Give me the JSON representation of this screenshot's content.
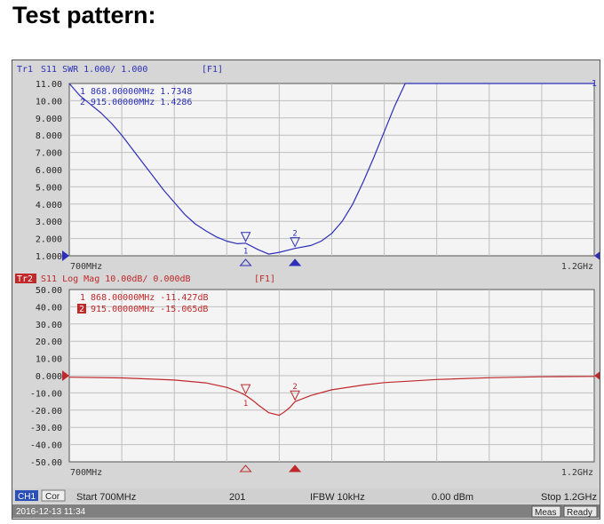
{
  "page_title": "Test pattern:",
  "colors": {
    "trace1": "#2b2fb8",
    "trace2": "#c0282a",
    "grid": "#bfbfbf",
    "screen_bg": "#d6d6d6",
    "header2_bg": "#c0282a"
  },
  "trace1": {
    "id": "Tr1",
    "header": "S11  SWR 1.000/ 1.000",
    "channel_tag": "[F1]",
    "marker_lines": [
      "1  868.00000MHz  1.7348",
      "2  915.00000MHz  1.4286"
    ],
    "y_ticks": [
      "11.00",
      "10.00",
      "9.000",
      "8.000",
      "7.000",
      "6.000",
      "5.000",
      "4.000",
      "3.000",
      "2.000",
      "1.000"
    ],
    "x_start_label": "700MHz",
    "x_stop_label": "1.2GHz",
    "right_ref_label": "1",
    "marker_numbers": [
      "1",
      "2"
    ]
  },
  "trace2": {
    "id": "Tr2",
    "header": "S11  Log Mag 10.00dB/ 0.000dB",
    "channel_tag": "[F1]",
    "marker_line1": "1  868.00000MHz  -11.427dB",
    "marker_line2_num": "2",
    "marker_line2": "915.00000MHz  -15.065dB",
    "y_ticks": [
      "50.00",
      "40.00",
      "30.00",
      "20.00",
      "10.00",
      "0.000",
      "-10.00",
      "-20.00",
      "-30.00",
      "-40.00",
      "-50.00"
    ],
    "x_start_label": "700MHz",
    "x_stop_label": "1.2GHz",
    "marker_numbers": [
      "1",
      "2"
    ]
  },
  "status_bar": {
    "channel": "CH1",
    "correction": "Cor",
    "start": "Start 700MHz",
    "points": "201",
    "ifbw": "IFBW 10kHz",
    "power": "0.00 dBm",
    "stop": "Stop 1.2GHz"
  },
  "bottom_bar": {
    "timestamp": "2016-12-13 11:34",
    "meas": "Meas",
    "ready": "Ready"
  },
  "chart_data": [
    {
      "type": "line",
      "series": [
        {
          "x": [
            700,
            710,
            720,
            730,
            740,
            750,
            760,
            770,
            780,
            790,
            800,
            810,
            820,
            830,
            840,
            850,
            860,
            868,
            880,
            890,
            900,
            915,
            930,
            940,
            950,
            960,
            970,
            980,
            990,
            1000,
            1010,
            1020,
            1030,
            1040,
            1050,
            1200
          ],
          "y": [
            11.0,
            10.3,
            9.8,
            9.3,
            8.7,
            8.0,
            7.2,
            6.4,
            5.6,
            4.8,
            4.1,
            3.4,
            2.85,
            2.45,
            2.1,
            1.85,
            1.7,
            1.73,
            1.35,
            1.1,
            1.2,
            1.43,
            1.6,
            1.85,
            2.3,
            3.0,
            4.0,
            5.3,
            6.7,
            8.2,
            9.7,
            11.0,
            11.0,
            11.0,
            11.0,
            11.0
          ]
        }
      ],
      "xlim": [
        700,
        1200
      ],
      "ylim": [
        1.0,
        11.0
      ],
      "markers": [
        {
          "n": 1,
          "x": 868,
          "y": 1.7348
        },
        {
          "n": 2,
          "x": 915,
          "y": 1.4286
        }
      ]
    },
    {
      "type": "line",
      "series": [
        {
          "x": [
            700,
            750,
            800,
            830,
            850,
            860,
            868,
            875,
            880,
            890,
            900,
            905,
            910,
            915,
            930,
            950,
            980,
            1000,
            1050,
            1100,
            1150,
            1200
          ],
          "y": [
            -0.9,
            -1.3,
            -2.5,
            -4.2,
            -6.8,
            -9.0,
            -11.43,
            -14.5,
            -17.0,
            -21.5,
            -23.0,
            -21.0,
            -18.5,
            -15.07,
            -11.5,
            -8.2,
            -5.4,
            -4.0,
            -2.2,
            -1.2,
            -0.6,
            -0.4
          ]
        }
      ],
      "xlim": [
        700,
        1200
      ],
      "ylim": [
        -50,
        50
      ],
      "markers": [
        {
          "n": 1,
          "x": 868,
          "y": -11.427
        },
        {
          "n": 2,
          "x": 915,
          "y": -15.065
        }
      ]
    }
  ]
}
